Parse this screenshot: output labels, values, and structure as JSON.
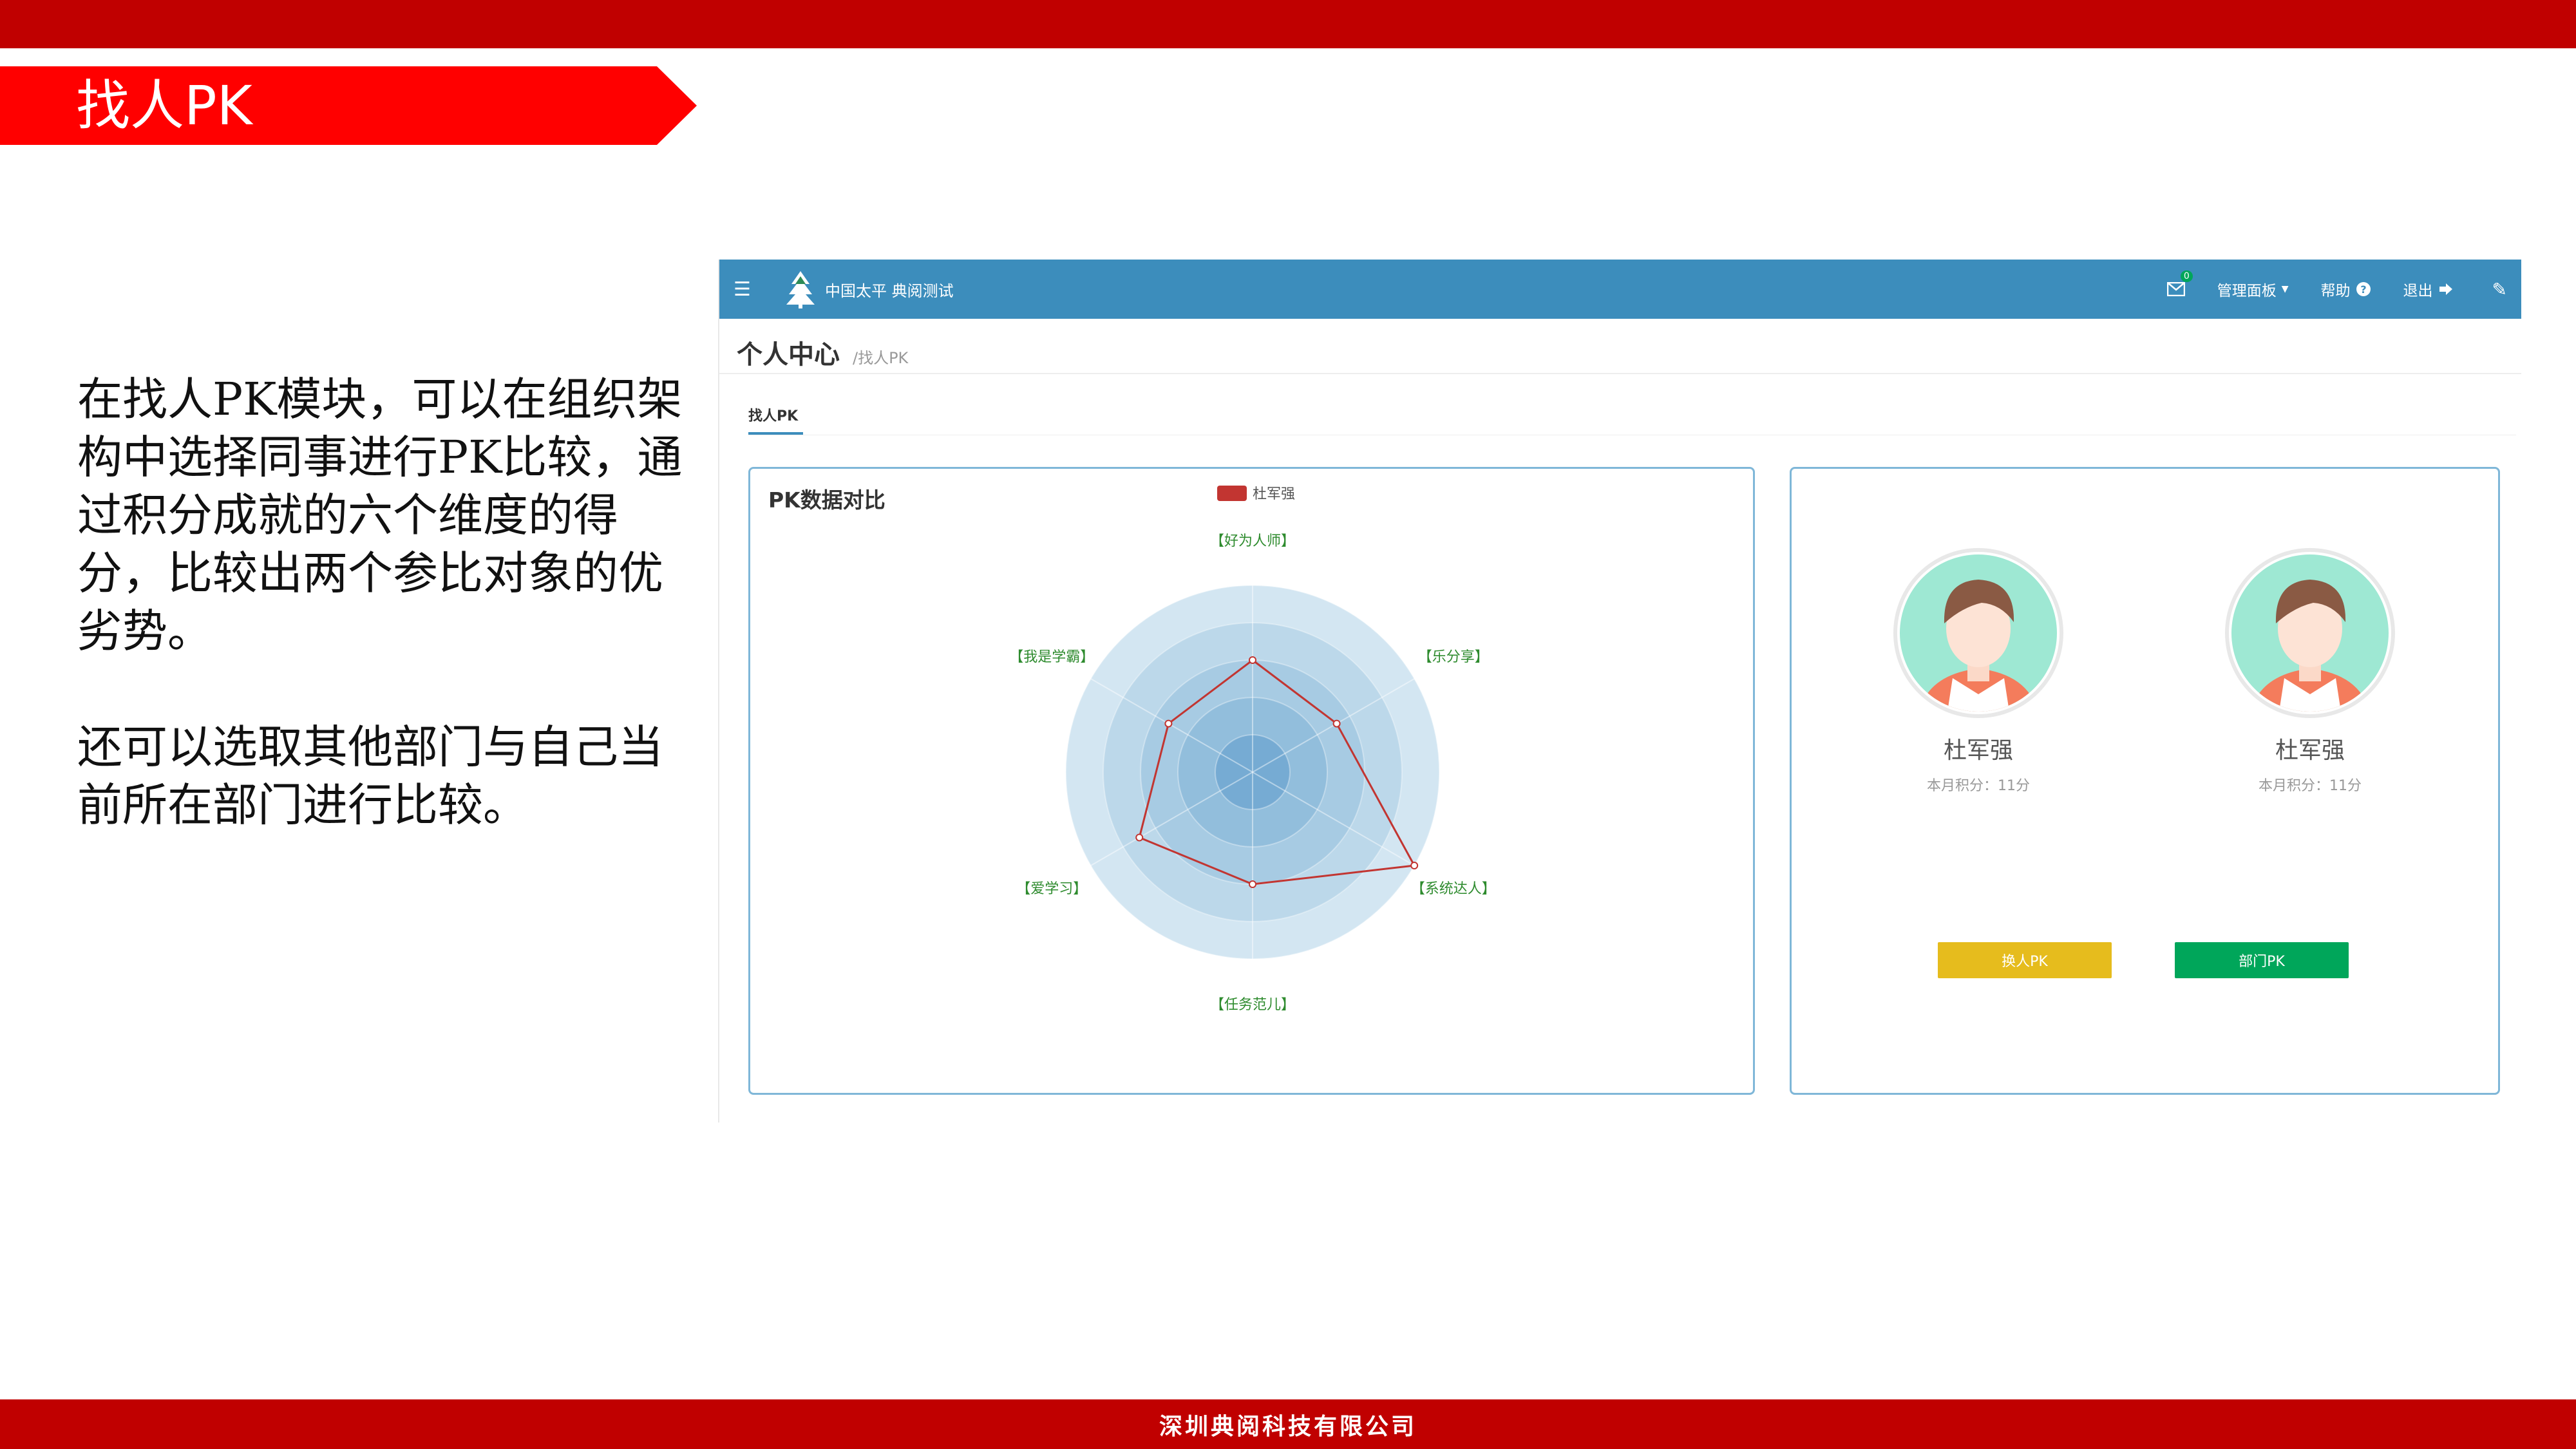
{
  "slide": {
    "title": "找人PK",
    "paragraph1": "在找人PK模块，可以在组织架构中选择同事进行PK比较，通过积分成就的六个维度的得分，比较出两个参比对象的优劣势。",
    "paragraph2": "还可以选取其他部门与自己当前所在部门进行比较。",
    "footer": "深圳典阅科技有限公司",
    "accent_color": "#c00000",
    "banner_color": "#ff0000"
  },
  "app": {
    "brand": "中国太平 典阅测试",
    "mail_badge": "0",
    "nav": {
      "admin_panel": "管理面板",
      "help": "帮助",
      "logout": "退出"
    },
    "page_title": "个人中心",
    "breadcrumb": "/找人PK",
    "tab": "找人PK",
    "nav_color": "#3c8dbc",
    "chart_panel_title": "PK数据对比",
    "players": [
      {
        "name": "杜军强",
        "score": "本月积分：11分"
      },
      {
        "name": "杜军强",
        "score": "本月积分：11分"
      }
    ],
    "buttons": {
      "change_person": "换人PK",
      "department": "部门PK"
    }
  },
  "chart_data": {
    "type": "radar",
    "title": "PK数据对比",
    "indicators": [
      "【好为人师】",
      "【乐分享】",
      "【系统达人】",
      "【任务范儿】",
      "【爱学习】",
      "【我是学霸】"
    ],
    "max": 5,
    "rings": 5,
    "series": [
      {
        "name": "杜军强",
        "color": "#c23531",
        "values": [
          3,
          2.6,
          5,
          3,
          3.5,
          2.6
        ]
      }
    ],
    "legend": "top-center"
  }
}
